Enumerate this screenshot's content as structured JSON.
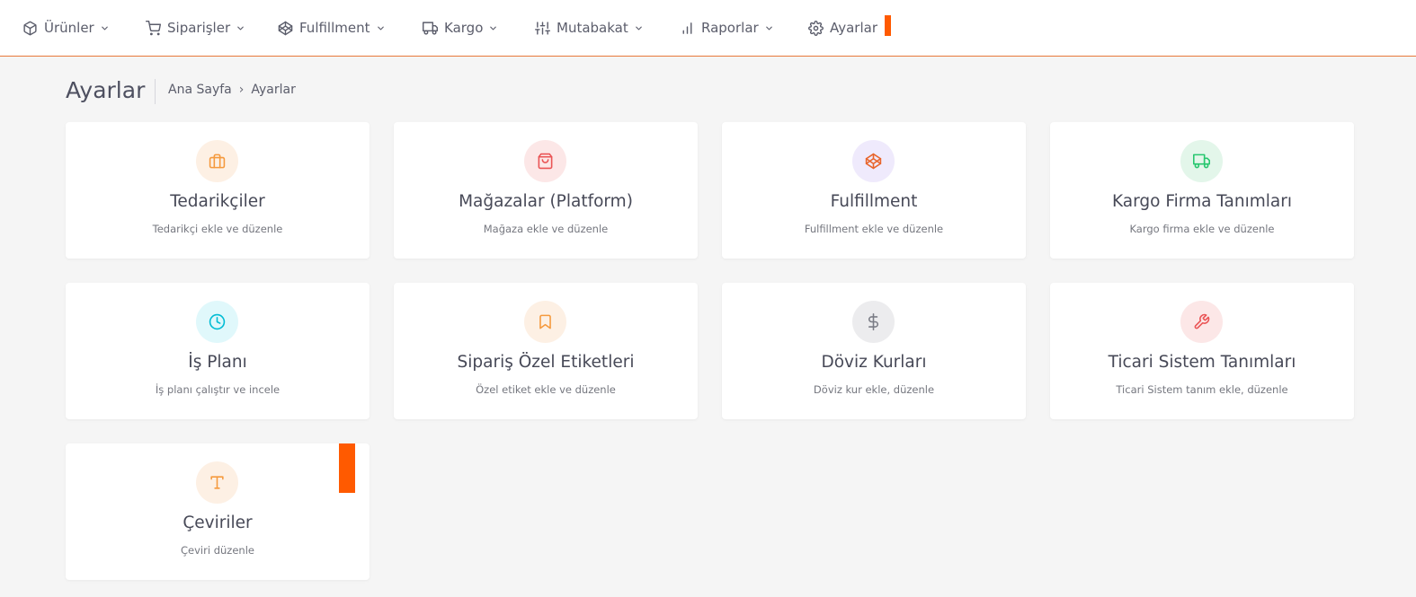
{
  "nav": {
    "items": [
      {
        "label": "Ürünler",
        "icon": "box-icon"
      },
      {
        "label": "Siparişler",
        "icon": "cart-icon"
      },
      {
        "label": "Fulfillment",
        "icon": "codepen-icon"
      },
      {
        "label": "Kargo",
        "icon": "truck-icon"
      },
      {
        "label": "Mutabakat",
        "icon": "sliders-icon"
      },
      {
        "label": "Raporlar",
        "icon": "bar-chart-icon"
      },
      {
        "label": "Ayarlar",
        "icon": "gear-icon"
      }
    ]
  },
  "header": {
    "title": "Ayarlar",
    "breadcrumb": {
      "home": "Ana Sayfa",
      "separator": "›",
      "current": "Ayarlar"
    }
  },
  "cards": [
    {
      "title": "Tedarikçiler",
      "subtitle": "Tedarikçi ekle ve düzenle",
      "icon": "briefcase-icon",
      "color": "#f59a3e",
      "bg": "#fdf0e4"
    },
    {
      "title": "Mağazalar (Platform)",
      "subtitle": "Mağaza ekle ve düzenle",
      "icon": "shopping-bag-icon",
      "color": "#ea5455",
      "bg": "#fce7e7"
    },
    {
      "title": "Fulfillment",
      "subtitle": "Fulfillment ekle ve düzenle",
      "icon": "codepen-icon",
      "color": "#e8652c",
      "bg": "#efeafc"
    },
    {
      "title": "Kargo Firma Tanımları",
      "subtitle": "Kargo firma ekle ve düzenle",
      "icon": "truck-icon",
      "color": "#28c76f",
      "bg": "#e3f6ea"
    },
    {
      "title": "İş Planı",
      "subtitle": "İş planı çalıştır ve incele",
      "icon": "clock-icon",
      "color": "#00bcd4",
      "bg": "#e0f8fb"
    },
    {
      "title": "Sipariş Özel Etiketleri",
      "subtitle": "Özel etiket ekle ve düzenle",
      "icon": "bookmark-icon",
      "color": "#f59a3e",
      "bg": "#fdf0e4"
    },
    {
      "title": "Döviz Kurları",
      "subtitle": "Döviz kur ekle, düzenle",
      "icon": "dollar-icon",
      "color": "#7b7d86",
      "bg": "#ececee"
    },
    {
      "title": "Ticari Sistem Tanımları",
      "subtitle": "Ticari Sistem tanım ekle, düzenle",
      "icon": "wrench-icon",
      "color": "#ea5455",
      "bg": "#fce7e7"
    },
    {
      "title": "Çeviriler",
      "subtitle": "Çeviri düzenle",
      "icon": "type-icon",
      "color": "#f59a3e",
      "bg": "#fdf0e4"
    }
  ],
  "colors": {
    "accent": "#ff5a00",
    "nav_underline": "#e8783a",
    "background": "#f5f5f5"
  }
}
